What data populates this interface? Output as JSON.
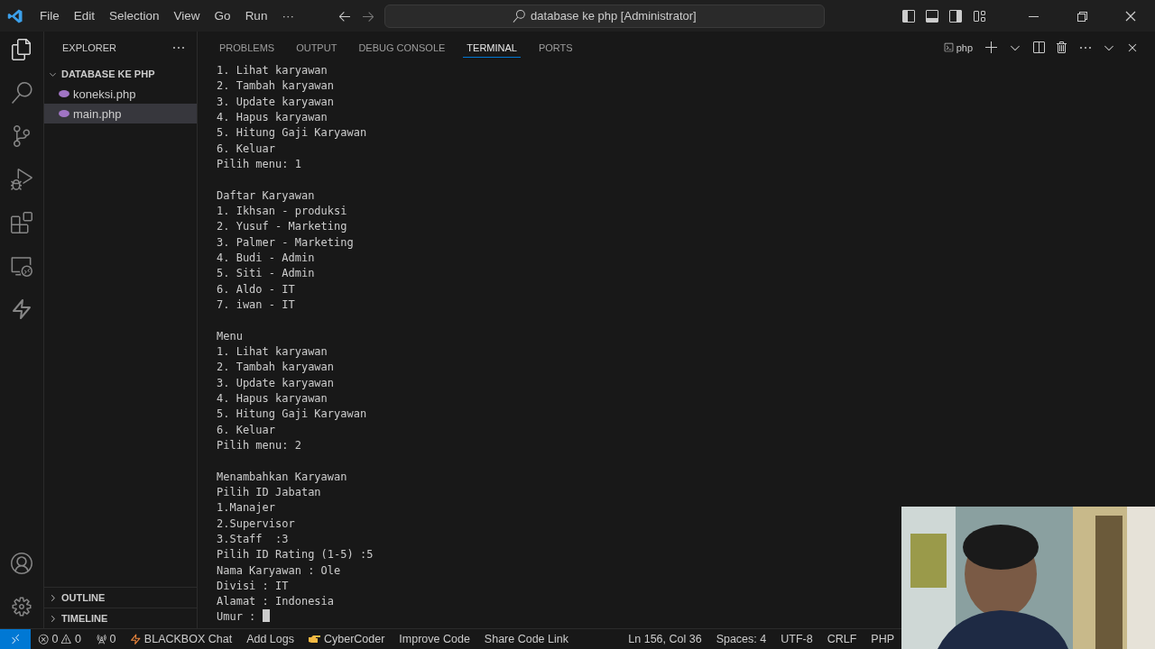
{
  "menu": [
    "File",
    "Edit",
    "Selection",
    "View",
    "Go",
    "Run",
    "···"
  ],
  "search": {
    "value": "database ke php [Administrator]"
  },
  "sidebar": {
    "title": "EXPLORER",
    "folder": {
      "label": "DATABASE KE PHP",
      "expanded": true,
      "children": [
        {
          "label": "koneksi.php",
          "selected": false
        },
        {
          "label": "main.php",
          "selected": true
        }
      ]
    },
    "sections": [
      {
        "label": "OUTLINE",
        "expanded": false
      },
      {
        "label": "TIMELINE",
        "expanded": false
      }
    ]
  },
  "panel_tabs": [
    {
      "label": "PROBLEMS",
      "selected": false
    },
    {
      "label": "OUTPUT",
      "selected": false
    },
    {
      "label": "DEBUG CONSOLE",
      "selected": false
    },
    {
      "label": "TERMINAL",
      "selected": true
    },
    {
      "label": "PORTS",
      "selected": false
    }
  ],
  "terminal_name": "php",
  "terminal": {
    "blocks": [
      [
        "1. Lihat karyawan",
        "2. Tambah karyawan",
        "3. Update karyawan",
        "4. Hapus karyawan",
        "5. Hitung Gaji Karyawan",
        "6. Keluar",
        "Pilih menu: 1"
      ],
      [
        "Daftar Karyawan",
        "1. Ikhsan - produksi",
        "2. Yusuf - Marketing",
        "3. Palmer - Marketing",
        "4. Budi - Admin",
        "5. Siti - Admin",
        "6. Aldo - IT",
        "7. iwan - IT"
      ],
      [
        "Menu",
        "1. Lihat karyawan",
        "2. Tambah karyawan",
        "3. Update karyawan",
        "4. Hapus karyawan",
        "5. Hitung Gaji Karyawan",
        "6. Keluar",
        "Pilih menu: 2"
      ],
      [
        "Menambahkan Karyawan",
        "Pilih ID Jabatan",
        "1.Manajer",
        "2.Supervisor",
        "3.Staff  :3",
        "Pilih ID Rating (1-5) :5",
        "Nama Karyawan : Ole",
        "Divisi : IT",
        "Alamat : Indonesia",
        "Umur :"
      ]
    ]
  },
  "status_bar": {
    "errors": "0",
    "warnings": "0",
    "ports": "0",
    "left": [
      {
        "kind": "bolt",
        "label": "BLACKBOX Chat"
      },
      {
        "kind": "plain",
        "label": "Add Logs"
      },
      {
        "kind": "hand",
        "label": "CyberCoder"
      },
      {
        "kind": "plain",
        "label": "Improve Code"
      },
      {
        "kind": "plain",
        "label": "Share Code Link"
      }
    ],
    "right": [
      "Ln 156, Col 36",
      "Spaces: 4",
      "UTF-8",
      "CRLF",
      "PHP"
    ]
  },
  "webcam": {
    "kind": "picture"
  }
}
